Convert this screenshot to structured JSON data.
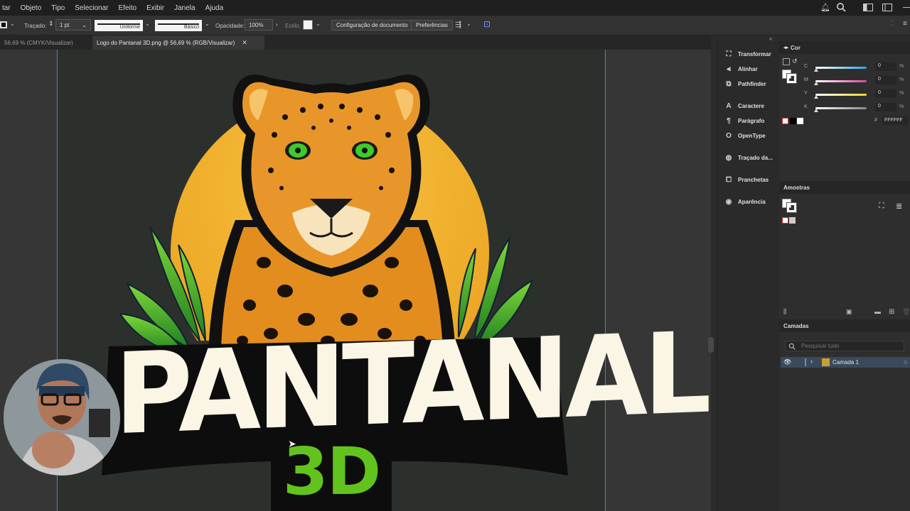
{
  "menu": {
    "items": [
      "tar",
      "Objeto",
      "Tipo",
      "Selecionar",
      "Efeito",
      "Exibir",
      "Janela",
      "Ajuda"
    ]
  },
  "control_bar": {
    "stroke_label": "Traçado:",
    "stroke_weight": "1 pt",
    "stroke_profile": "Uniforme",
    "brush": "Básico",
    "opacity_label": "Opacidade:",
    "opacity_value": "100%",
    "style_label": "Estilo:",
    "doc_setup_button": "Configuração de documento",
    "preferences_button": "Preferências"
  },
  "tabs": [
    {
      "label": "56,69 % (CMYK/Visualizar)",
      "active": false
    },
    {
      "label": "Logo do Pantanal 3D.png @ 56,69 % (RGB/Visualizar)",
      "active": true
    }
  ],
  "tab_close_glyph": "✕",
  "artwork": {
    "headline": "PANTANAL",
    "subline": "3D",
    "headline_color": "#fbf5e6",
    "subline_color": "#62c31e",
    "sun_color": "#f5b52c"
  },
  "panel_list": [
    {
      "label": "Transformar",
      "icon": "transform-icon"
    },
    {
      "label": "Alinhar",
      "icon": "align-icon"
    },
    {
      "label": "Pathfinder",
      "icon": "pathfinder-icon"
    },
    {
      "label": "Caractere",
      "icon": "character-icon"
    },
    {
      "label": "Parágrafo",
      "icon": "paragraph-icon"
    },
    {
      "label": "OpenType",
      "icon": "opentype-icon"
    },
    {
      "label": "Traçado da...",
      "icon": "image-trace-icon"
    },
    {
      "label": "Pranchetas",
      "icon": "artboards-icon"
    },
    {
      "label": "Aparência",
      "icon": "appearance-icon"
    }
  ],
  "color_panel": {
    "title": "Cor",
    "sliders": [
      {
        "label": "C",
        "value": "0",
        "unit": "%",
        "color": "#2aa7e0"
      },
      {
        "label": "M",
        "value": "0",
        "unit": "%",
        "color": "#e0449a"
      },
      {
        "label": "Y",
        "value": "0",
        "unit": "%",
        "color": "#e8d82a"
      },
      {
        "label": "K",
        "value": "0",
        "unit": "%",
        "color": "#888888"
      }
    ],
    "hex": "FFFFFF"
  },
  "swatches_panel": {
    "title": "Amostras"
  },
  "layers_panel": {
    "title": "Camadas",
    "search_placeholder": "Pesquisar tudo",
    "layers": [
      {
        "name": "Camada 1",
        "visible": true
      }
    ]
  }
}
